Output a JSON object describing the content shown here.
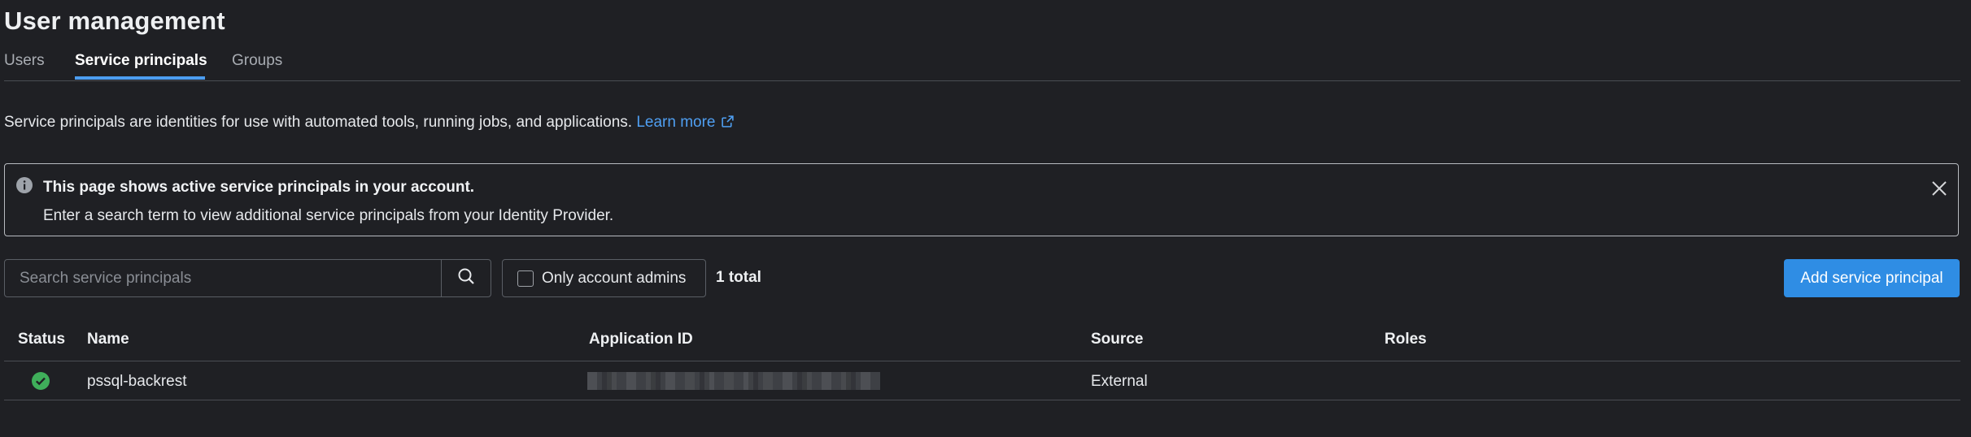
{
  "header": {
    "title": "User management"
  },
  "tabs": [
    {
      "label": "Users",
      "active": false
    },
    {
      "label": "Service principals",
      "active": true
    },
    {
      "label": "Groups",
      "active": false
    }
  ],
  "description": {
    "text": "Service principals are identities for use with automated tools, running jobs, and applications.",
    "link_label": "Learn more",
    "link_icon": "external-link-icon"
  },
  "banner": {
    "icon": "info-icon",
    "title": "This page shows active service principals in your account.",
    "text": "Enter a search term to view additional service principals from your Identity Provider.",
    "close_icon": "close-icon"
  },
  "toolbar": {
    "search_placeholder": "Search service principals",
    "search_value": "",
    "search_icon": "search-icon",
    "admins_filter_label": "Only account admins",
    "admins_filter_checked": false,
    "total_label": "1 total",
    "add_button_label": "Add service principal"
  },
  "table": {
    "columns": [
      "Status",
      "Name",
      "Application ID",
      "Source",
      "Roles"
    ],
    "rows": [
      {
        "status": "active",
        "status_icon": "check-circle-icon",
        "name": "pssql-backrest",
        "application_id": "",
        "source": "External",
        "roles": ""
      }
    ]
  },
  "colors": {
    "background": "#1f2024",
    "accent": "#2f8de4",
    "link": "#4f9ff2",
    "success": "#3fae5a",
    "border": "#4a4d53"
  }
}
